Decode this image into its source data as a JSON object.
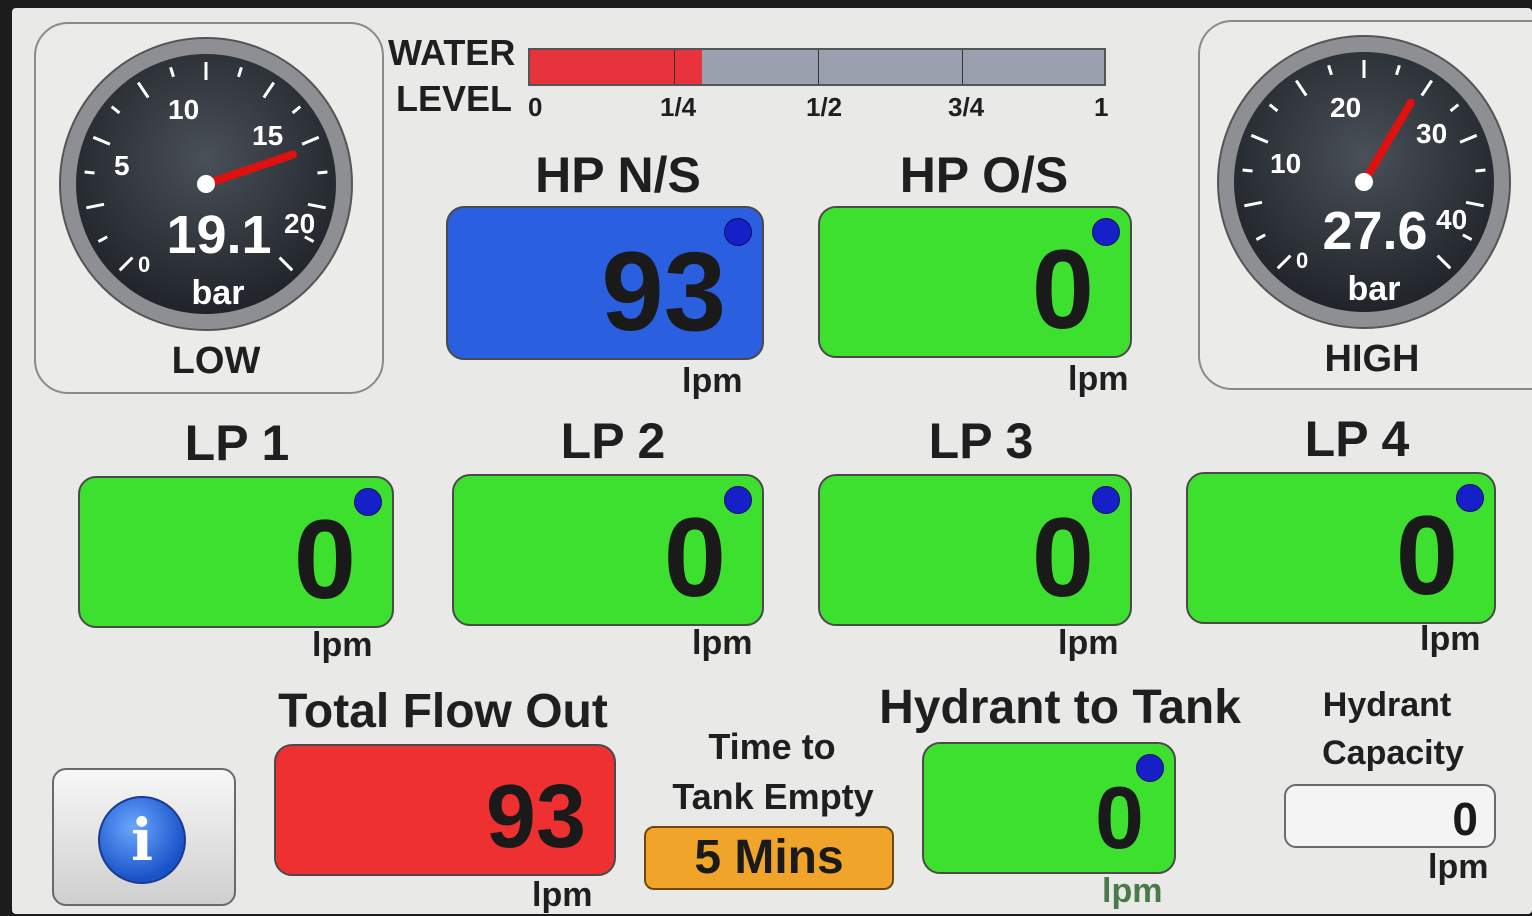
{
  "water_level": {
    "label_line1": "WATER",
    "label_line2": "LEVEL",
    "ticks": [
      "0",
      "1/4",
      "1/2",
      "3/4",
      "1"
    ],
    "fill_fraction": 0.3,
    "fill_color": "#e8333c"
  },
  "low_gauge": {
    "value": "19.1",
    "unit": "bar",
    "label": "LOW",
    "ticks": [
      "5",
      "10",
      "15",
      "20"
    ],
    "zero": "0",
    "needle_value": 19.1
  },
  "high_gauge": {
    "value": "27.6",
    "unit": "bar",
    "label": "HIGH",
    "ticks": [
      "10",
      "20",
      "30",
      "40"
    ],
    "zero": "0",
    "needle_value": 27.6
  },
  "hp_ns": {
    "title": "HP N/S",
    "value": "93",
    "unit": "lpm",
    "color": "#2a5fe0"
  },
  "hp_os": {
    "title": "HP O/S",
    "value": "0",
    "unit": "lpm",
    "color": "#3ee030"
  },
  "lp": [
    {
      "title": "LP 1",
      "value": "0",
      "unit": "lpm"
    },
    {
      "title": "LP 2",
      "value": "0",
      "unit": "lpm"
    },
    {
      "title": "LP 3",
      "value": "0",
      "unit": "lpm"
    },
    {
      "title": "LP 4",
      "value": "0",
      "unit": "lpm"
    }
  ],
  "total_flow": {
    "title": "Total Flow Out",
    "value": "93",
    "unit": "lpm",
    "color": "#ee3030"
  },
  "time_to_empty": {
    "line1": "Time to",
    "line2": "Tank Empty",
    "value": "5 Mins",
    "color": "#f0a52a"
  },
  "hydrant_to_tank": {
    "title": "Hydrant to Tank",
    "value": "0",
    "unit": "lpm"
  },
  "hydrant_capacity": {
    "line1": "Hydrant",
    "line2": "Capacity",
    "value": "0",
    "unit": "lpm"
  },
  "info_button": {
    "glyph": "i",
    "icon": "info-icon"
  }
}
